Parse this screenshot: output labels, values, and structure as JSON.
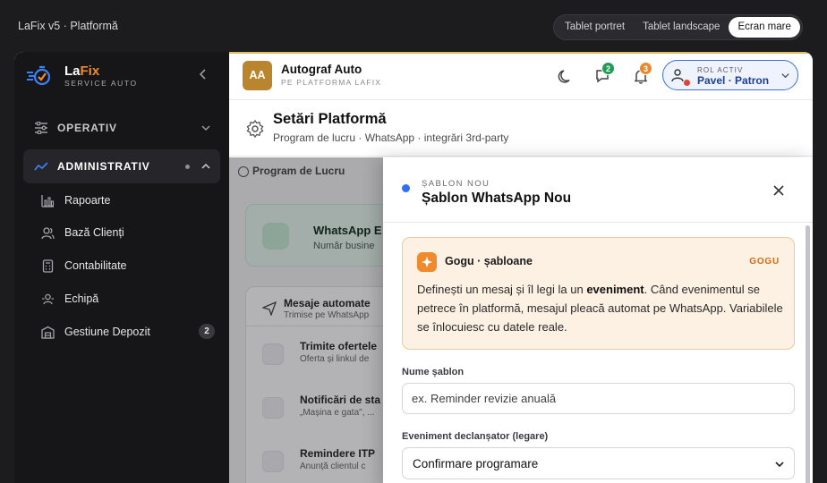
{
  "app": {
    "title": "LaFix v5 · Platformă"
  },
  "viewport_switch": {
    "options": [
      "Tablet portret",
      "Tablet landscape",
      "Ecran mare"
    ],
    "selected": "Ecran mare"
  },
  "sidebar": {
    "brand": {
      "la": "La",
      "fix": "Fix",
      "sub": "SERVICE AUTO"
    },
    "sections": [
      {
        "label": "OPERATIV",
        "expanded": false
      },
      {
        "label": "ADMINISTRATIV",
        "expanded": true
      }
    ],
    "items": [
      {
        "label": "Rapoarte",
        "icon": "bar-chart-icon"
      },
      {
        "label": "Bază Clienți",
        "icon": "users-icon"
      },
      {
        "label": "Contabilitate",
        "icon": "calculator-icon"
      },
      {
        "label": "Echipă",
        "icon": "team-icon"
      },
      {
        "label": "Gestiune Depozit",
        "icon": "warehouse-icon",
        "badge": "2"
      }
    ]
  },
  "header": {
    "company_initials": "AA",
    "company_name": "Autograf Auto",
    "company_sub": "PE PLATFORMA LAFIX",
    "messages_badge": "2",
    "notifications_badge": "3",
    "role_label": "ROL ACTIV",
    "role_name": "Pavel · Patron",
    "colors": {
      "messages_badge": "#1f9d57",
      "notifications_badge": "#e8892b",
      "role_accent": "#3b6fe0"
    }
  },
  "page": {
    "title": "Setări Platformă",
    "subtitle": "Program de lucru · WhatsApp · integrări 3rd-party"
  },
  "background": {
    "tab": "Program de Lucru",
    "card_title": "WhatsApp E",
    "card_sub": "Număr busine",
    "list_title": "Mesaje automate",
    "list_sub": "Trimise pe WhatsApp",
    "rows": [
      {
        "title": "Trimite ofertele",
        "sub": "Oferta și linkul de"
      },
      {
        "title": "Notificări de sta",
        "sub": "„Mașina e gata\", ..."
      },
      {
        "title": "Remindere ITP",
        "sub": "Anunță clientul c"
      }
    ]
  },
  "panel": {
    "kicker": "ȘABLON NOU",
    "title": "Șablon WhatsApp Nou",
    "info": {
      "title": "Gogu · șabloane",
      "tag": "GOGU",
      "text_before": "Definești un mesaj și îl legi la un ",
      "text_bold": "eveniment",
      "text_after": ". Când evenimentul se petrece în platformă, mesajul pleacă automat pe WhatsApp. Variabilele se înlocuiesc cu datele reale."
    },
    "name_field": {
      "label": "Nume șablon",
      "placeholder": "ex. Reminder revizie anuală",
      "value": ""
    },
    "trigger_field": {
      "label": "Eveniment declanșator (legare)",
      "value": "Confirmare programare"
    }
  }
}
